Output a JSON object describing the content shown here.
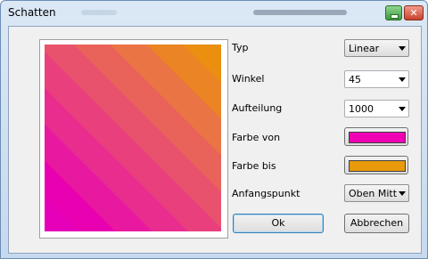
{
  "window": {
    "title": "Schatten",
    "close_glyph": "✕",
    "icons": {
      "minimize": "minimize-icon",
      "close": "close-icon"
    }
  },
  "preview": {
    "gradient_from": "#f000b4",
    "gradient_to": "#ea8c0f",
    "stripe_colors": [
      "#e600b9",
      "#e900b0",
      "#e918a0",
      "#e92d8f",
      "#e9407d",
      "#e9526c",
      "#e9635a",
      "#ea7444",
      "#ea8424",
      "#ea8f10"
    ]
  },
  "form": {
    "typ": {
      "label": "Typ",
      "value": "Linear"
    },
    "winkel": {
      "label": "Winkel",
      "value": "45"
    },
    "aufteilung": {
      "label": "Aufteilung",
      "value": "1000"
    },
    "farbe_von": {
      "label": "Farbe von",
      "color": "#f000b4"
    },
    "farbe_bis": {
      "label": "Farbe bis",
      "color": "#e89a0b"
    },
    "anfangspunkt": {
      "label": "Anfangspunkt",
      "value": "Oben Mitte"
    }
  },
  "buttons": {
    "ok": "Ok",
    "cancel": "Abbrechen"
  }
}
